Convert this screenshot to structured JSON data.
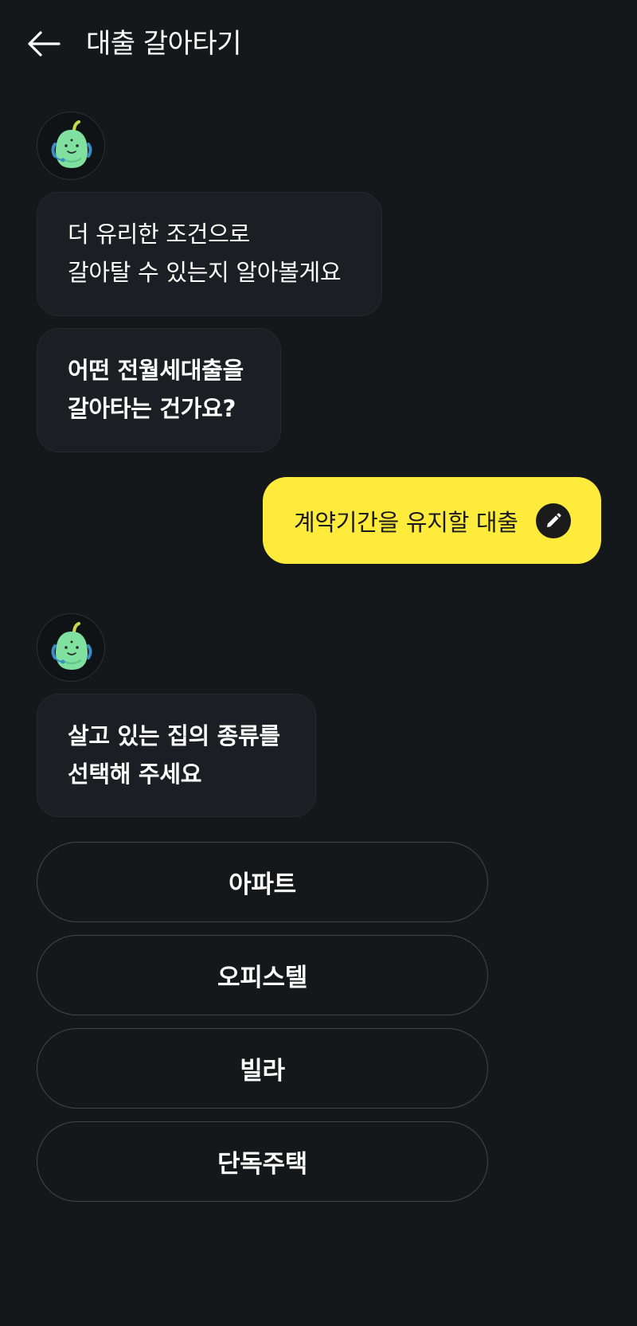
{
  "header": {
    "title": "대출 갈아타기"
  },
  "messages": {
    "bot1": {
      "lines": [
        "더 유리한 조건으로",
        "갈아탈 수 있는지 알아볼게요"
      ]
    },
    "bot2": {
      "lines": [
        "어떤 전월세대출을",
        "갈아타는 건가요?"
      ]
    },
    "user1": {
      "text": "계약기간을 유지할 대출"
    },
    "bot3": {
      "lines": [
        "살고 있는 집의 종류를",
        "선택해 주세요"
      ]
    }
  },
  "options": [
    {
      "label": "아파트"
    },
    {
      "label": "오피스텔"
    },
    {
      "label": "빌라"
    },
    {
      "label": "단독주택"
    }
  ],
  "colors": {
    "background": "#15181b",
    "bubble": "#1b1e22",
    "user_bubble": "#ffeb3b",
    "option_border": "#42464c",
    "mascot": "#7fe0a0"
  },
  "icons": {
    "back": "back-arrow-icon",
    "edit": "pencil-icon",
    "avatar": "mascot-avatar-icon"
  }
}
